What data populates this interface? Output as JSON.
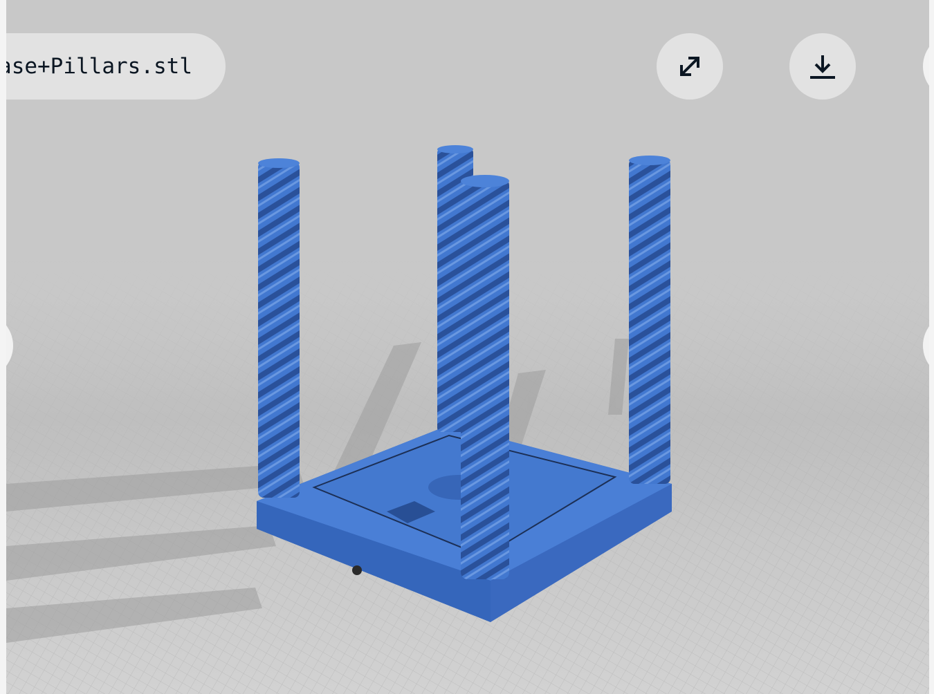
{
  "viewer": {
    "file_name": "ase+Pillars.stl",
    "model_color": "#3f72c9",
    "buttons": {
      "fullscreen_icon": "expand-arrows-icon",
      "download_icon": "download-icon"
    }
  }
}
